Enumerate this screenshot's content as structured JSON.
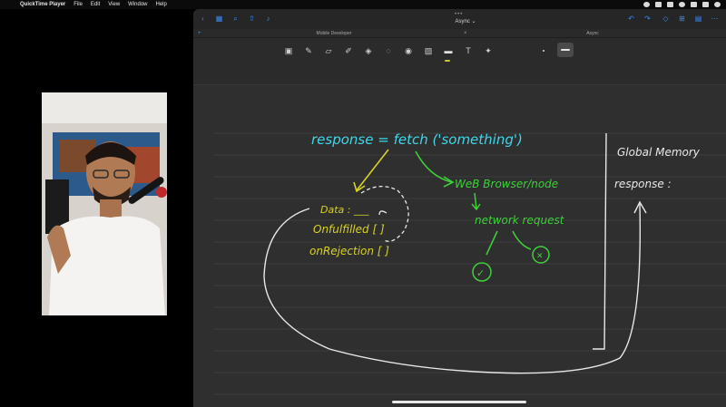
{
  "menubar": {
    "app_name": "QuickTime Player",
    "items": [
      "File",
      "Edit",
      "View",
      "Window",
      "Help"
    ]
  },
  "window": {
    "document_title": "Async ⌄",
    "tabs": [
      "Mobile Developer",
      "Async"
    ]
  },
  "toolbar": {
    "tools": [
      "image-tool-icon",
      "pen-icon",
      "eraser-icon",
      "highlighter-icon",
      "shapes-icon",
      "lasso-icon",
      "elements-icon",
      "photo-icon",
      "laser-pointer-icon",
      "text-icon",
      "magic-icon"
    ],
    "active_tool": "laser-pointer-icon"
  },
  "canvas": {
    "line1": "response = fetch ('something')",
    "data_label": "Data : ___",
    "on_fulfilled": "Onfulfilled [ ]",
    "on_rejection": "onRejection [ ]",
    "web_browser": "WeB Browser/node",
    "network_request": "network request",
    "global_memory": "Global Memory",
    "response_label": "response :",
    "success_mark": "✓",
    "fail_mark": "✕"
  },
  "colors": {
    "cyan": "#3fd7e8",
    "green": "#3fcf3a",
    "yellow": "#d8d126",
    "white_ink": "#e8e8e8",
    "accent": "#3a8cf0"
  }
}
